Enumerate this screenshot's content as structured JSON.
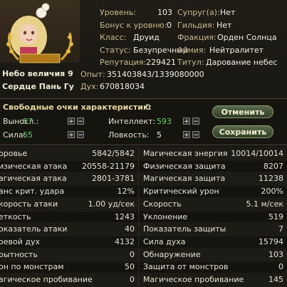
{
  "banner": {
    "line1": "Небо величия 9",
    "line2": "Сердце Пань Гу"
  },
  "profile": {
    "level_label": "Уровень:",
    "level_value": "103",
    "bonus_label": "Бонус к уровню:",
    "bonus_value": "0",
    "class_label": "Класс:",
    "class_value": "Друид",
    "status_label": "Статус:",
    "status_value": "Безупречный",
    "reputation_label": "Репутация:",
    "reputation_value": "229421",
    "exp_label": "Опыт:",
    "exp_value": "351403843/1339080000",
    "spirit_label": "Дух:",
    "spirit_value": "670818034",
    "spouse_label": "Супруг(а):",
    "spouse_value": "Нет",
    "guild_label": "Гильдия:",
    "guild_value": "Нет",
    "faction_label": "Фракция:",
    "faction_value": "Орден Солнца",
    "army_label": "Армия:",
    "army_value": "Нейтралитет",
    "title_label": "Титул:",
    "title_value": "Дарование небес"
  },
  "points": {
    "free_label": "Свободные очки характеристик:",
    "free_value": "0",
    "stamina_label": "Выносл.:",
    "stamina_value": "57",
    "strength_label": "Сила:",
    "strength_value": "65",
    "intellect_label": "Интеллект:",
    "intellect_value": "593",
    "agility_label": "Ловкость:",
    "agility_value": "5",
    "plus": "+",
    "minus": "−",
    "cancel_button": "Отменить",
    "save_button": "Сохранить"
  },
  "stats": [
    {
      "l": "оровье",
      "lv": "5842/5842",
      "r": "Магическая энергия",
      "rv": "10014/10014"
    },
    {
      "l": "изическая атака",
      "lv": "20558-21179",
      "r": "Физическая защита",
      "rv": "8207"
    },
    {
      "l": "агическая атака",
      "lv": "2801-3781",
      "r": "Магическая защита",
      "rv": "11238"
    },
    {
      "l": "анс крит. удара",
      "lv": "12%",
      "r": "Критический урон",
      "rv": "200%"
    },
    {
      "l": "корость атаки",
      "lv": "1.00 уд/сек",
      "r": "Скорость",
      "rv": "5.1 м/сек"
    },
    {
      "l": "еткость",
      "lv": "1243",
      "r": "Уклонение",
      "rv": "519"
    },
    {
      "l": "оказатель атаки",
      "lv": "40",
      "r": "Показатель защиты",
      "rv": "7"
    },
    {
      "l": "оевой дух",
      "lv": "4132",
      "r": "Сила духа",
      "rv": "15794"
    },
    {
      "l": "рытность",
      "lv": "0",
      "r": "Обнаружение",
      "rv": "103"
    },
    {
      "l": "он по монстрам",
      "lv": "50",
      "r": "Защита от монстров",
      "rv": "0"
    },
    {
      "l": "агическое пробивание",
      "lv": "0",
      "r": "Магическое пробивание",
      "rv": "145"
    }
  ]
}
